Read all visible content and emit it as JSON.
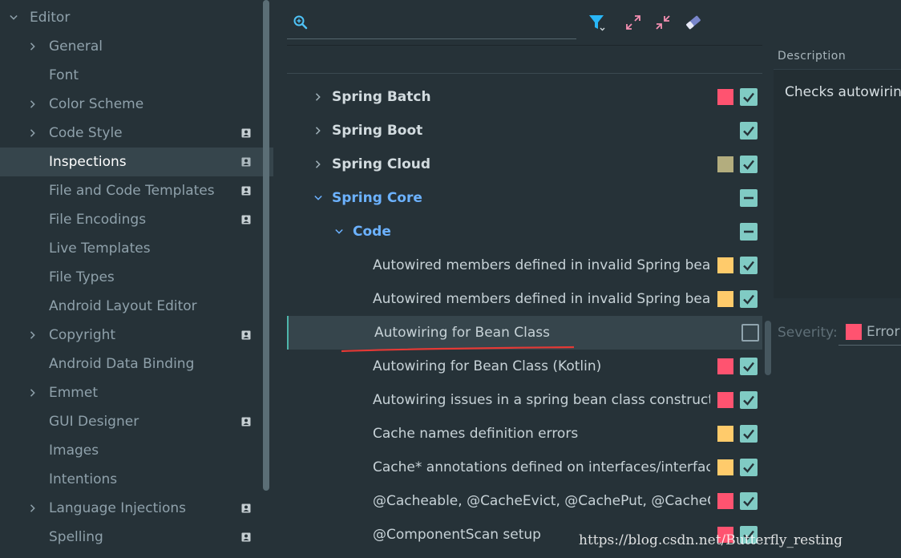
{
  "colors": {
    "background": "#263238",
    "selection": "#36454c",
    "checkbox": "#80cbc4",
    "error": "#ff5370",
    "warning": "#ffcb6b",
    "weak_warning": "#b3ad7e",
    "accent_blue": "#6cb2ff",
    "underline_red": "#e53935"
  },
  "sidebar": {
    "section_title": "Editor",
    "items": [
      {
        "label": "General",
        "chevron": true,
        "badge": false
      },
      {
        "label": "Font",
        "chevron": false,
        "badge": false
      },
      {
        "label": "Color Scheme",
        "chevron": true,
        "badge": false
      },
      {
        "label": "Code Style",
        "chevron": true,
        "badge": true
      },
      {
        "label": "Inspections",
        "chevron": false,
        "badge": true,
        "selected": true
      },
      {
        "label": "File and Code Templates",
        "chevron": false,
        "badge": true
      },
      {
        "label": "File Encodings",
        "chevron": false,
        "badge": true
      },
      {
        "label": "Live Templates",
        "chevron": false,
        "badge": false
      },
      {
        "label": "File Types",
        "chevron": false,
        "badge": false
      },
      {
        "label": "Android Layout Editor",
        "chevron": false,
        "badge": false
      },
      {
        "label": "Copyright",
        "chevron": true,
        "badge": true
      },
      {
        "label": "Android Data Binding",
        "chevron": false,
        "badge": false
      },
      {
        "label": "Emmet",
        "chevron": true,
        "badge": false
      },
      {
        "label": "GUI Designer",
        "chevron": false,
        "badge": true
      },
      {
        "label": "Images",
        "chevron": false,
        "badge": false
      },
      {
        "label": "Intentions",
        "chevron": false,
        "badge": false
      },
      {
        "label": "Language Injections",
        "chevron": true,
        "badge": true
      },
      {
        "label": "Spelling",
        "chevron": false,
        "badge": true
      }
    ]
  },
  "toolbar": {
    "search_placeholder": "",
    "search_value": "",
    "icons": [
      "filter-icon",
      "expand-all-icon",
      "collapse-all-icon",
      "eraser-icon"
    ]
  },
  "tree": [
    {
      "label": "Spring Batch",
      "level": 0,
      "chevron": "right",
      "style": "bold",
      "severity": "error",
      "check": "on"
    },
    {
      "label": "Spring Boot",
      "level": 0,
      "chevron": "right",
      "style": "bold",
      "severity": "none",
      "check": "on"
    },
    {
      "label": "Spring Cloud",
      "level": 0,
      "chevron": "right",
      "style": "bold",
      "severity": "weak_warning",
      "check": "on"
    },
    {
      "label": "Spring Core",
      "level": 0,
      "chevron": "down",
      "style": "blue",
      "severity": "none",
      "check": "partial"
    },
    {
      "label": "Code",
      "level": 1,
      "chevron": "down",
      "style": "blue",
      "severity": "none",
      "check": "partial"
    },
    {
      "label": "Autowired members defined in invalid Spring bean",
      "level": 2,
      "chevron": "none",
      "style": "normal",
      "severity": "warning",
      "check": "on"
    },
    {
      "label": "Autowired members defined in invalid Spring bean (Ko",
      "level": 2,
      "chevron": "none",
      "style": "normal",
      "severity": "warning",
      "check": "on"
    },
    {
      "label": "Autowiring for Bean Class",
      "level": 2,
      "chevron": "none",
      "style": "normal",
      "severity": "none",
      "check": "off",
      "selected": true
    },
    {
      "label": "Autowiring for Bean Class (Kotlin)",
      "level": 2,
      "chevron": "none",
      "style": "normal",
      "severity": "error",
      "check": "on"
    },
    {
      "label": "Autowiring issues in a spring bean class constructors",
      "level": 2,
      "chevron": "none",
      "style": "normal",
      "severity": "error",
      "check": "on"
    },
    {
      "label": "Cache names definition errors",
      "level": 2,
      "chevron": "none",
      "style": "normal",
      "severity": "warning",
      "check": "on"
    },
    {
      "label": "Cache* annotations defined on interfaces/interface m",
      "level": 2,
      "chevron": "none",
      "style": "normal",
      "severity": "warning",
      "check": "on"
    },
    {
      "label": "@Cacheable, @CacheEvict, @CachePut, @CacheCon",
      "level": 2,
      "chevron": "none",
      "style": "normal",
      "severity": "error",
      "check": "on"
    },
    {
      "label": "@ComponentScan setup",
      "level": 2,
      "chevron": "none",
      "style": "normal",
      "severity": "error",
      "check": "on"
    }
  ],
  "description": {
    "tab_label": "Description",
    "text": "Checks autowiring"
  },
  "severity": {
    "label": "Severity:",
    "value": "Error"
  },
  "watermark": "https://blog.csdn.net/Butterfly_resting"
}
